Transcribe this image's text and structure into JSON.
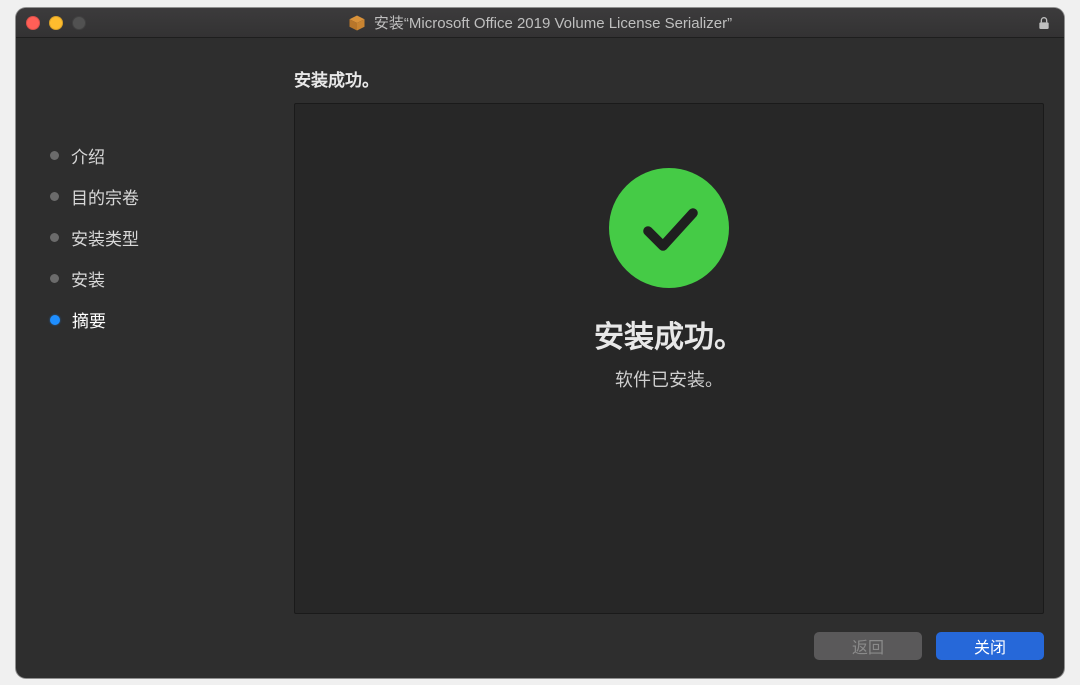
{
  "titlebar": {
    "title": "安装“Microsoft Office 2019 Volume License Serializer”"
  },
  "heading": "安装成功。",
  "sidebar": {
    "items": [
      {
        "label": "介绍"
      },
      {
        "label": "目的宗卷"
      },
      {
        "label": "安装类型"
      },
      {
        "label": "安装"
      },
      {
        "label": "摘要"
      }
    ],
    "activeIndex": 4
  },
  "content": {
    "big": "安装成功。",
    "sub": "软件已安装。"
  },
  "footer": {
    "back": "返回",
    "close": "关闭"
  }
}
